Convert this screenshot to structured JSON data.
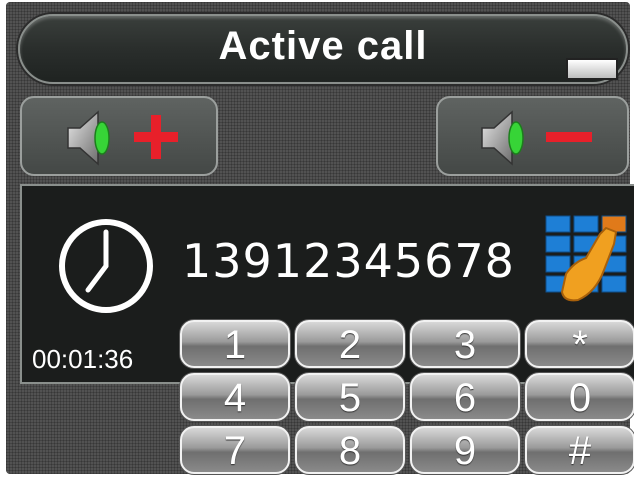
{
  "header": {
    "title": "Active call"
  },
  "controls": {
    "volume_up": {
      "icon": "speaker-plus-icon"
    },
    "volume_down": {
      "icon": "speaker-minus-icon"
    },
    "minimize": {
      "icon": "minimize-icon"
    }
  },
  "call": {
    "number": "13912345678",
    "duration": "00:01:36",
    "clock_icon": "clock-icon",
    "dialpad_icon": "dialpad-icon"
  },
  "keypad": {
    "keys": [
      "1",
      "2",
      "3",
      "*",
      "4",
      "5",
      "6",
      "0",
      "7",
      "8",
      "9",
      "#"
    ]
  },
  "colors": {
    "accent_plus": "#e8202a",
    "accent_minus": "#e8202a",
    "speaker_green": "#37d437",
    "dialpad_blue": "#1e7fd6",
    "hand_orange": "#f0a020"
  }
}
